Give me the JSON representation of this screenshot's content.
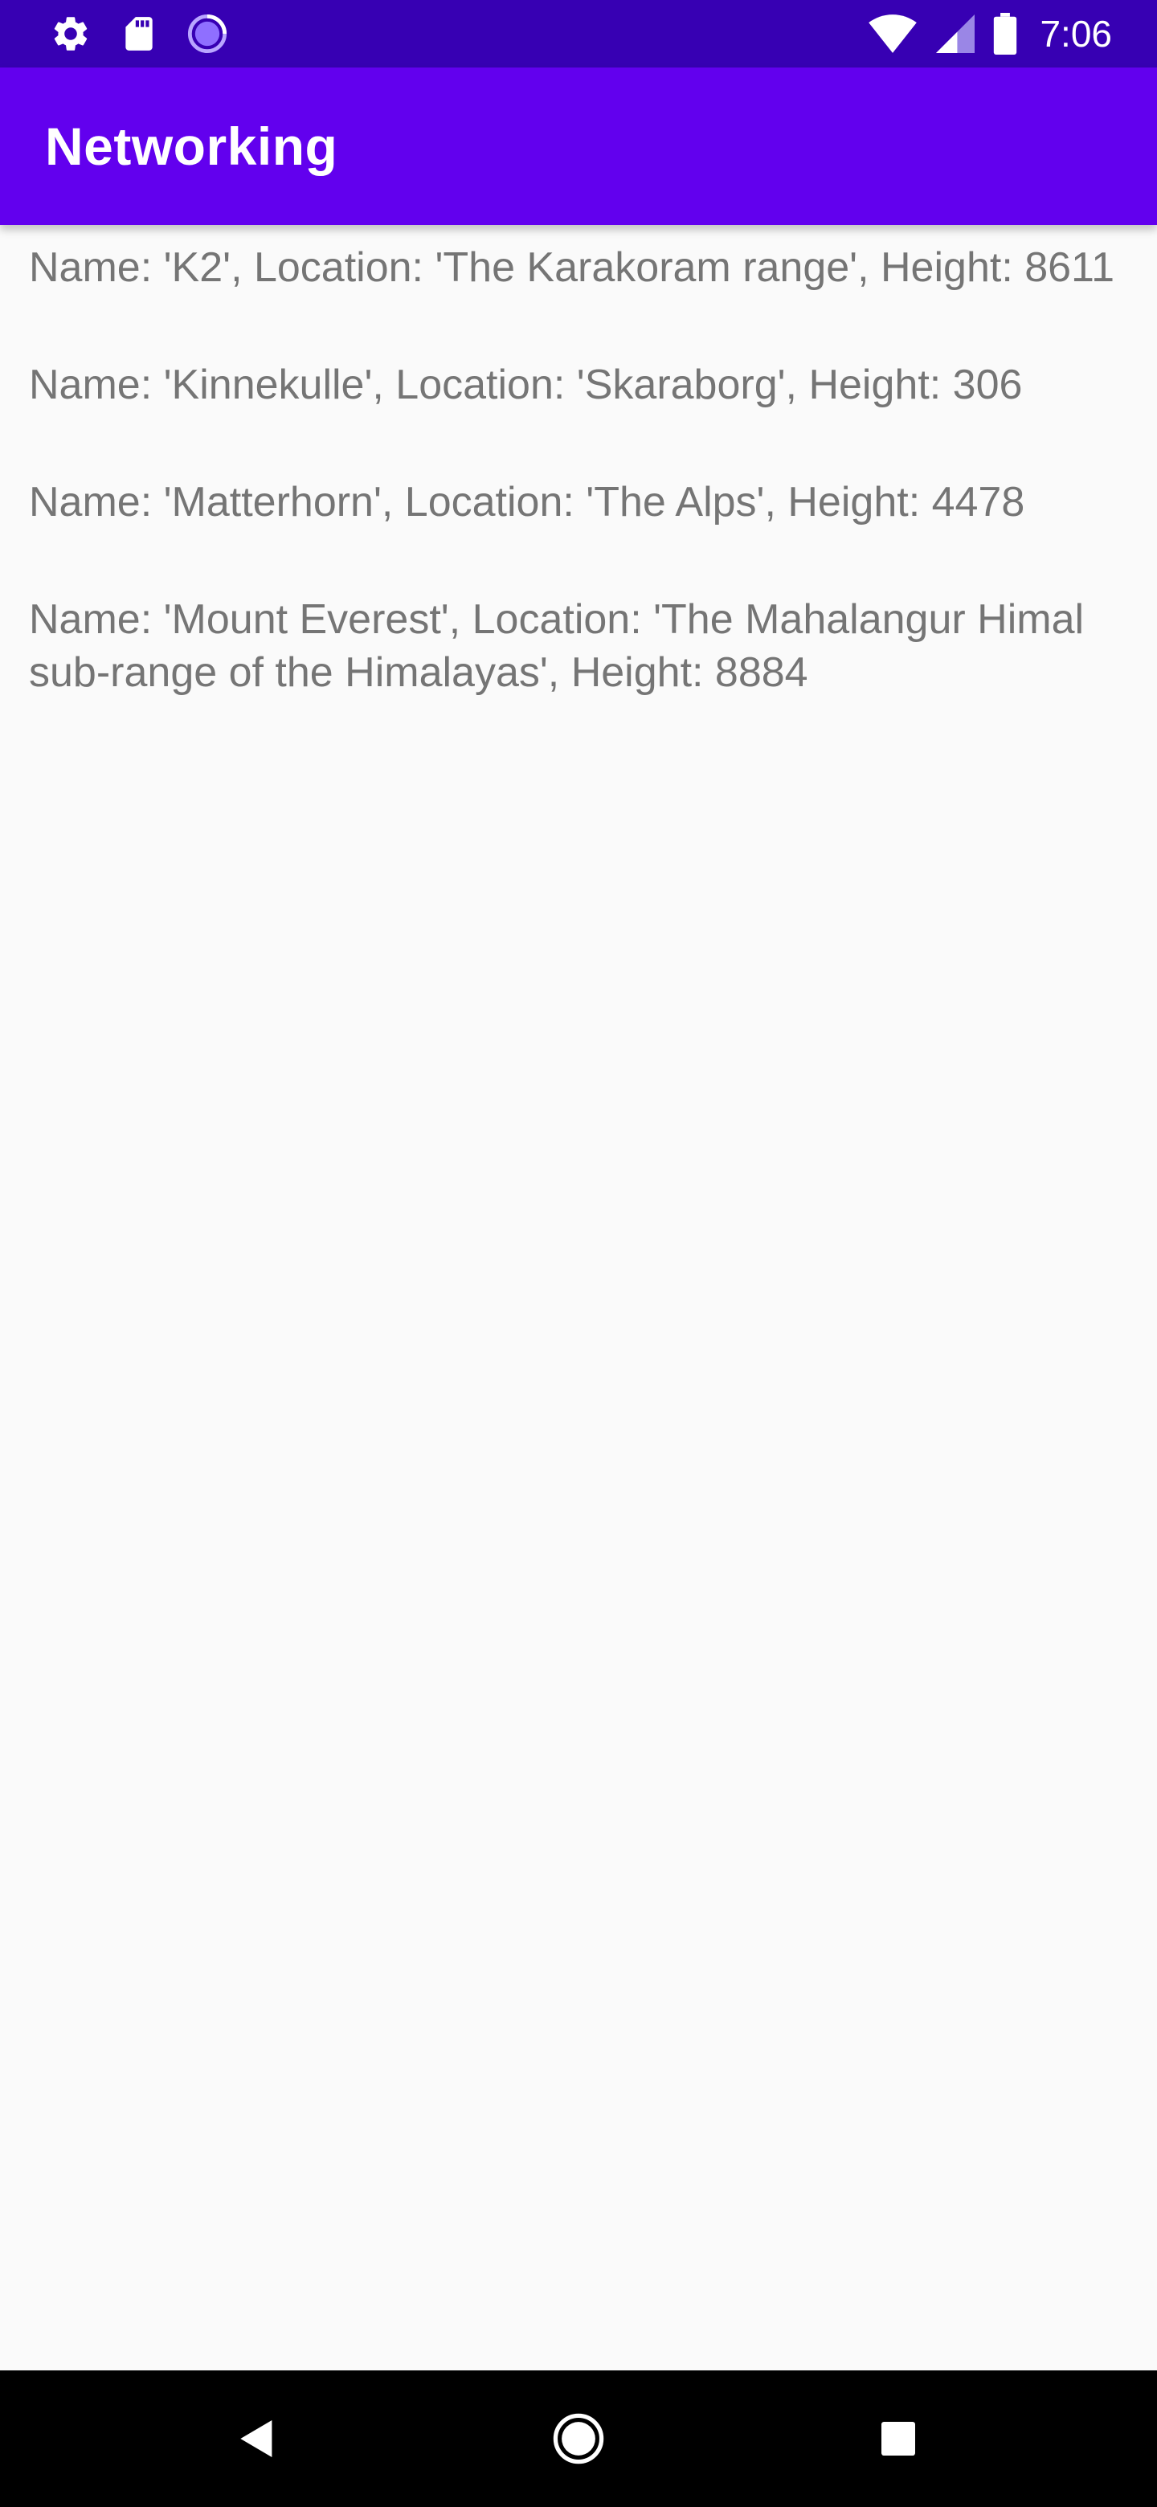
{
  "status_bar": {
    "time": "7:06",
    "left_icons": [
      "gear-icon",
      "sd-card-icon",
      "loading-circle-icon"
    ],
    "right_icons": [
      "wifi-icon",
      "cell-signal-icon",
      "battery-icon"
    ]
  },
  "app_bar": {
    "title": "Networking"
  },
  "mountains": [
    {
      "text": "Name: 'K2', Location: 'The Karakoram range', Height: 8611"
    },
    {
      "text": "Name: 'Kinnekulle', Location: 'Skaraborg', Height: 306"
    },
    {
      "text": "Name: 'Matterhorn', Location: 'The Alps', Height: 4478"
    },
    {
      "text": "Name: 'Mount Everest', Location: 'The Mahalangur Himal sub-range of the Himalayas', Height: 8884"
    }
  ],
  "nav_bar": {
    "buttons": [
      "back-icon",
      "home-icon",
      "recents-icon"
    ]
  },
  "colors": {
    "status_bar": "#3700b3",
    "app_bar": "#6200ee",
    "background": "#fafafa",
    "text": "#757575"
  }
}
